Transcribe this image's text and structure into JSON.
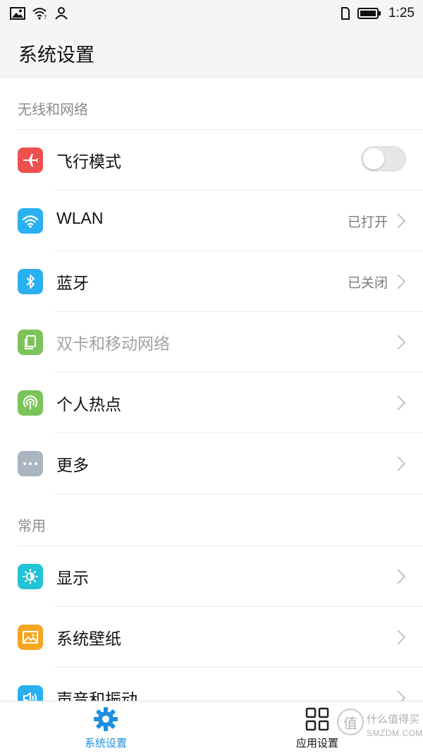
{
  "status_bar": {
    "time": "1:25",
    "left_icons": [
      "image-icon",
      "wifi-question-icon",
      "user-icon"
    ],
    "right_icons": [
      "sim-card-icon",
      "battery-icon"
    ]
  },
  "header": {
    "title": "系统设置"
  },
  "sections": [
    {
      "title": "无线和网络",
      "items": [
        {
          "label": "飞行模式",
          "icon": "airplane-icon",
          "icon_color": "#ee5050",
          "control": "toggle",
          "toggle_on": false
        },
        {
          "label": "WLAN",
          "icon": "wifi-icon",
          "icon_color": "#29b0f0",
          "value": "已打开"
        },
        {
          "label": "蓝牙",
          "icon": "bluetooth-icon",
          "icon_color": "#29b0f0",
          "value": "已关闭"
        },
        {
          "label": "双卡和移动网络",
          "icon": "dual-sim-icon",
          "icon_color": "#7cc45a",
          "disabled": true
        },
        {
          "label": "个人热点",
          "icon": "hotspot-icon",
          "icon_color": "#7cc45a"
        },
        {
          "label": "更多",
          "icon": "more-icon",
          "icon_color": "#a9b5c0"
        }
      ]
    },
    {
      "title": "常用",
      "items": [
        {
          "label": "显示",
          "icon": "brightness-icon",
          "icon_color": "#22c3d6"
        },
        {
          "label": "系统壁纸",
          "icon": "wallpaper-icon",
          "icon_color": "#f5a623"
        },
        {
          "label": "声音和振动",
          "icon": "sound-icon",
          "icon_color": "#29b0f0"
        }
      ]
    }
  ],
  "bottom_nav": {
    "tabs": [
      {
        "label": "系统设置",
        "icon": "gear-icon",
        "active": true
      },
      {
        "label": "应用设置",
        "icon": "grid-icon",
        "active": false
      }
    ],
    "accent_color": "#1e8ee0"
  },
  "watermark": {
    "text": "什么值得买",
    "domain": "SMZDM.COM",
    "glyph": "值"
  }
}
